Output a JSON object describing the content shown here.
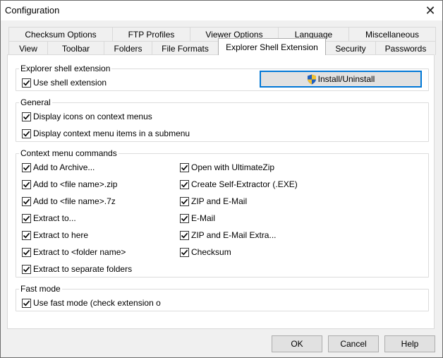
{
  "window": {
    "title": "Configuration"
  },
  "tabs_top": [
    "Checksum Options",
    "FTP Profiles",
    "Viewer Options",
    "Language",
    "Miscellaneous"
  ],
  "tabs_bottom": [
    "View",
    "Toolbar",
    "Folders",
    "File Formats",
    "Explorer Shell Extension",
    "Security",
    "Passwords"
  ],
  "active_tab": "Explorer Shell Extension",
  "shell_group": {
    "title": "Explorer shell extension",
    "use_shell_label": "Use shell extension",
    "use_shell_checked": true,
    "install_button": "Install/Uninstall"
  },
  "general_group": {
    "title": "General",
    "items": [
      {
        "label": "Display icons on context menus",
        "checked": true
      },
      {
        "label": "Display context menu items in a submenu",
        "checked": true
      }
    ]
  },
  "context_group": {
    "title": "Context menu commands",
    "left": [
      {
        "label": "Add to Archive...",
        "checked": true
      },
      {
        "label": "Add to <file name>.zip",
        "checked": true
      },
      {
        "label": "Add to <file name>.7z",
        "checked": true
      },
      {
        "label": "Extract to...",
        "checked": true
      },
      {
        "label": "Extract to here",
        "checked": true
      },
      {
        "label": "Extract to <folder name>",
        "checked": true
      },
      {
        "label": "Extract to separate folders",
        "checked": true
      }
    ],
    "right": [
      {
        "label": "Open with UltimateZip",
        "checked": true
      },
      {
        "label": "Create Self-Extractor (.EXE)",
        "checked": true
      },
      {
        "label": "ZIP and E-Mail",
        "checked": true
      },
      {
        "label": "E-Mail",
        "checked": true
      },
      {
        "label": "ZIP and E-Mail Extra...",
        "checked": true
      },
      {
        "label": "Checksum",
        "checked": true
      }
    ]
  },
  "fast_group": {
    "title": "Fast mode",
    "label": "Use fast mode (check extension only",
    "checked": true
  },
  "buttons": {
    "ok": "OK",
    "cancel": "Cancel",
    "help": "Help"
  },
  "colors": {
    "focus_border": "#0078d7",
    "shield_blue": "#1f5fbf",
    "shield_yellow": "#f2c12e"
  }
}
